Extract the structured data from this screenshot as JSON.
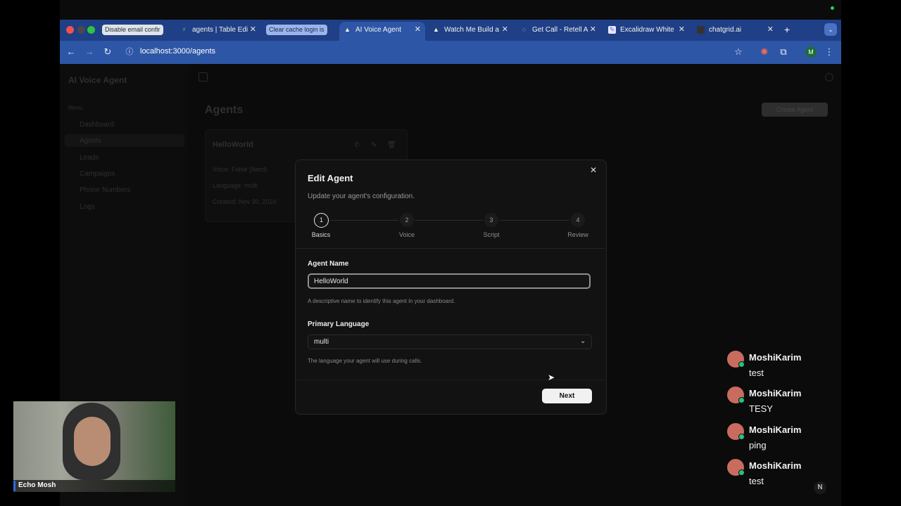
{
  "browser": {
    "tabs": [
      {
        "label": "Disable email confir",
        "style": "highlight"
      },
      {
        "label": "agents | Table Edi",
        "style": "normal"
      },
      {
        "label": "Clear cache login is",
        "style": "highlight-blue"
      },
      {
        "label": "AI Voice Agent",
        "style": "active"
      },
      {
        "label": "Watch Me Build a",
        "style": "normal"
      },
      {
        "label": "Get Call - Retell A",
        "style": "normal"
      },
      {
        "label": "Excalidraw White",
        "style": "normal"
      },
      {
        "label": "chatgrid.ai",
        "style": "normal"
      }
    ],
    "url": "localhost:3000/agents",
    "profile_initial": "M"
  },
  "app": {
    "brand": "AI Voice Agent",
    "sidebar_section": "Menu",
    "sidebar_items": [
      "Dashboard",
      "Agents",
      "Leads",
      "Campaigns",
      "Phone Numbers",
      "Logs"
    ],
    "page_title": "Agents",
    "create_button": "Create Agent",
    "card": {
      "title": "HelloWorld",
      "voice": "Voice: Fable (Nerd)",
      "language": "Language: multi",
      "created": "Created: Nov 30, 2024"
    }
  },
  "modal": {
    "title": "Edit Agent",
    "subtitle": "Update your agent's configuration.",
    "steps": [
      {
        "num": "1",
        "label": "Basics"
      },
      {
        "num": "2",
        "label": "Voice"
      },
      {
        "num": "3",
        "label": "Script"
      },
      {
        "num": "4",
        "label": "Review"
      }
    ],
    "agent_name_label": "Agent Name",
    "agent_name_value": "HelloWorld",
    "agent_name_help": "A descriptive name to identify this agent in your dashboard.",
    "language_label": "Primary Language",
    "language_value": "multi",
    "language_help": "The language your agent will use during calls.",
    "next_label": "Next"
  },
  "chat": [
    {
      "name": "MoshiKarim",
      "text": "test"
    },
    {
      "name": "MoshiKarim",
      "text": "TESY"
    },
    {
      "name": "MoshiKarim",
      "text": "ping"
    },
    {
      "name": "MoshiKarim",
      "text": "test"
    }
  ],
  "webcam": {
    "name": "Echo Mosh"
  }
}
